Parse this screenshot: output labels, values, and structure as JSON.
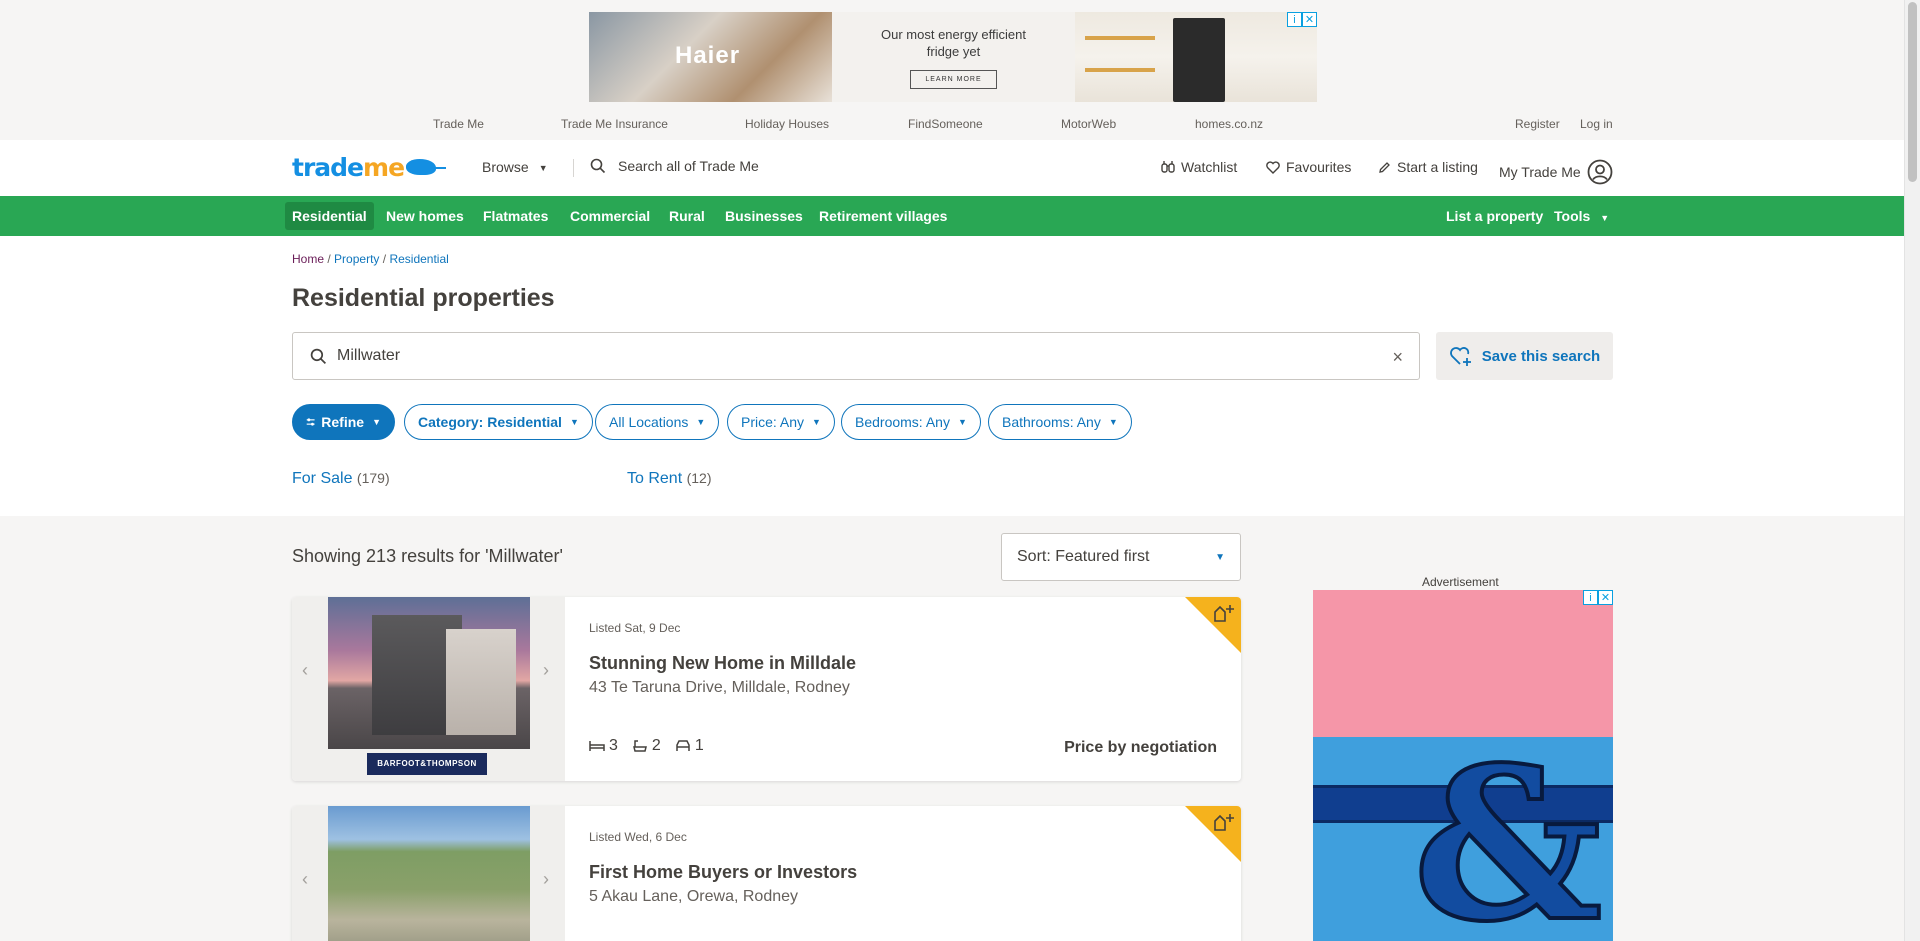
{
  "top_ad": {
    "brand": "Haier",
    "headline": "Our most energy efficient fridge yet",
    "cta": "LEARN MORE",
    "info_icon": "info-icon",
    "close_icon": "close-icon"
  },
  "site_links": [
    "Trade Me",
    "Trade Me Insurance",
    "Holiday Houses",
    "FindSomeone",
    "MotorWeb",
    "homes.co.nz"
  ],
  "account_links": {
    "register": "Register",
    "login": "Log in"
  },
  "header": {
    "logo_trade": "trade",
    "logo_me": "me",
    "browse": "Browse",
    "search_placeholder": "Search all of Trade Me",
    "watchlist": "Watchlist",
    "favourites": "Favourites",
    "start_listing": "Start a listing",
    "my_trade_me": "My Trade Me"
  },
  "nav": {
    "items": [
      "Residential",
      "New homes",
      "Flatmates",
      "Commercial",
      "Rural",
      "Businesses",
      "Retirement villages"
    ],
    "active": "Residential",
    "list_property": "List a property",
    "tools": "Tools"
  },
  "breadcrumb": {
    "home": "Home",
    "sep": "/",
    "property": "Property",
    "residential": "Residential"
  },
  "page_title": "Residential properties",
  "search": {
    "value": "Millwater",
    "clear": "×"
  },
  "save_search": "Save this search",
  "filters": {
    "refine": "Refine",
    "category": "Category: Residential",
    "locations": "All Locations",
    "price": "Price: Any",
    "bedrooms": "Bedrooms: Any",
    "bathrooms": "Bathrooms: Any"
  },
  "listing_tabs": {
    "for_sale": {
      "label": "For Sale",
      "count": "(179)"
    },
    "to_rent": {
      "label": "To Rent",
      "count": "(12)"
    }
  },
  "results": {
    "summary": "Showing 213 results for 'Millwater'",
    "sort": "Sort: Featured first"
  },
  "listings": [
    {
      "listed": "Listed Sat, 9 Dec",
      "title": "Stunning New Home in Milldale",
      "address": "43 Te Taruna Drive, Milldale, Rodney",
      "bedrooms": "3",
      "bathrooms": "2",
      "parking": "1",
      "price": "Price by negotiation",
      "agency": "BARFOOT&THOMPSON"
    },
    {
      "listed": "Listed Wed, 6 Dec",
      "title": "First Home Buyers or Investors",
      "address": "5 Akau Lane, Orewa, Rodney"
    }
  ],
  "side_ad": {
    "label": "Advertisement"
  },
  "colors": {
    "brand_blue": "#148fe2",
    "nav_green": "#29a754",
    "link_blue": "#0f75bc",
    "featured_gold": "#f5b21d"
  }
}
